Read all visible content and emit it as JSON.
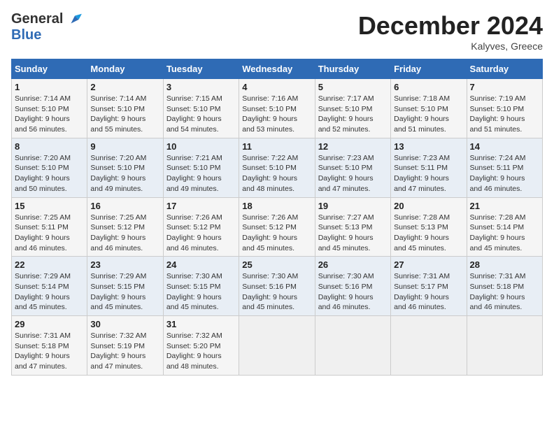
{
  "header": {
    "logo_line1": "General",
    "logo_line2": "Blue",
    "month": "December 2024",
    "location": "Kalyves, Greece"
  },
  "weekdays": [
    "Sunday",
    "Monday",
    "Tuesday",
    "Wednesday",
    "Thursday",
    "Friday",
    "Saturday"
  ],
  "weeks": [
    [
      {
        "day": "1",
        "info": "Sunrise: 7:14 AM\nSunset: 5:10 PM\nDaylight: 9 hours\nand 56 minutes."
      },
      {
        "day": "2",
        "info": "Sunrise: 7:14 AM\nSunset: 5:10 PM\nDaylight: 9 hours\nand 55 minutes."
      },
      {
        "day": "3",
        "info": "Sunrise: 7:15 AM\nSunset: 5:10 PM\nDaylight: 9 hours\nand 54 minutes."
      },
      {
        "day": "4",
        "info": "Sunrise: 7:16 AM\nSunset: 5:10 PM\nDaylight: 9 hours\nand 53 minutes."
      },
      {
        "day": "5",
        "info": "Sunrise: 7:17 AM\nSunset: 5:10 PM\nDaylight: 9 hours\nand 52 minutes."
      },
      {
        "day": "6",
        "info": "Sunrise: 7:18 AM\nSunset: 5:10 PM\nDaylight: 9 hours\nand 51 minutes."
      },
      {
        "day": "7",
        "info": "Sunrise: 7:19 AM\nSunset: 5:10 PM\nDaylight: 9 hours\nand 51 minutes."
      }
    ],
    [
      {
        "day": "8",
        "info": "Sunrise: 7:20 AM\nSunset: 5:10 PM\nDaylight: 9 hours\nand 50 minutes."
      },
      {
        "day": "9",
        "info": "Sunrise: 7:20 AM\nSunset: 5:10 PM\nDaylight: 9 hours\nand 49 minutes."
      },
      {
        "day": "10",
        "info": "Sunrise: 7:21 AM\nSunset: 5:10 PM\nDaylight: 9 hours\nand 49 minutes."
      },
      {
        "day": "11",
        "info": "Sunrise: 7:22 AM\nSunset: 5:10 PM\nDaylight: 9 hours\nand 48 minutes."
      },
      {
        "day": "12",
        "info": "Sunrise: 7:23 AM\nSunset: 5:10 PM\nDaylight: 9 hours\nand 47 minutes."
      },
      {
        "day": "13",
        "info": "Sunrise: 7:23 AM\nSunset: 5:11 PM\nDaylight: 9 hours\nand 47 minutes."
      },
      {
        "day": "14",
        "info": "Sunrise: 7:24 AM\nSunset: 5:11 PM\nDaylight: 9 hours\nand 46 minutes."
      }
    ],
    [
      {
        "day": "15",
        "info": "Sunrise: 7:25 AM\nSunset: 5:11 PM\nDaylight: 9 hours\nand 46 minutes."
      },
      {
        "day": "16",
        "info": "Sunrise: 7:25 AM\nSunset: 5:12 PM\nDaylight: 9 hours\nand 46 minutes."
      },
      {
        "day": "17",
        "info": "Sunrise: 7:26 AM\nSunset: 5:12 PM\nDaylight: 9 hours\nand 46 minutes."
      },
      {
        "day": "18",
        "info": "Sunrise: 7:26 AM\nSunset: 5:12 PM\nDaylight: 9 hours\nand 45 minutes."
      },
      {
        "day": "19",
        "info": "Sunrise: 7:27 AM\nSunset: 5:13 PM\nDaylight: 9 hours\nand 45 minutes."
      },
      {
        "day": "20",
        "info": "Sunrise: 7:28 AM\nSunset: 5:13 PM\nDaylight: 9 hours\nand 45 minutes."
      },
      {
        "day": "21",
        "info": "Sunrise: 7:28 AM\nSunset: 5:14 PM\nDaylight: 9 hours\nand 45 minutes."
      }
    ],
    [
      {
        "day": "22",
        "info": "Sunrise: 7:29 AM\nSunset: 5:14 PM\nDaylight: 9 hours\nand 45 minutes."
      },
      {
        "day": "23",
        "info": "Sunrise: 7:29 AM\nSunset: 5:15 PM\nDaylight: 9 hours\nand 45 minutes."
      },
      {
        "day": "24",
        "info": "Sunrise: 7:30 AM\nSunset: 5:15 PM\nDaylight: 9 hours\nand 45 minutes."
      },
      {
        "day": "25",
        "info": "Sunrise: 7:30 AM\nSunset: 5:16 PM\nDaylight: 9 hours\nand 45 minutes."
      },
      {
        "day": "26",
        "info": "Sunrise: 7:30 AM\nSunset: 5:16 PM\nDaylight: 9 hours\nand 46 minutes."
      },
      {
        "day": "27",
        "info": "Sunrise: 7:31 AM\nSunset: 5:17 PM\nDaylight: 9 hours\nand 46 minutes."
      },
      {
        "day": "28",
        "info": "Sunrise: 7:31 AM\nSunset: 5:18 PM\nDaylight: 9 hours\nand 46 minutes."
      }
    ],
    [
      {
        "day": "29",
        "info": "Sunrise: 7:31 AM\nSunset: 5:18 PM\nDaylight: 9 hours\nand 47 minutes."
      },
      {
        "day": "30",
        "info": "Sunrise: 7:32 AM\nSunset: 5:19 PM\nDaylight: 9 hours\nand 47 minutes."
      },
      {
        "day": "31",
        "info": "Sunrise: 7:32 AM\nSunset: 5:20 PM\nDaylight: 9 hours\nand 48 minutes."
      },
      null,
      null,
      null,
      null
    ]
  ]
}
